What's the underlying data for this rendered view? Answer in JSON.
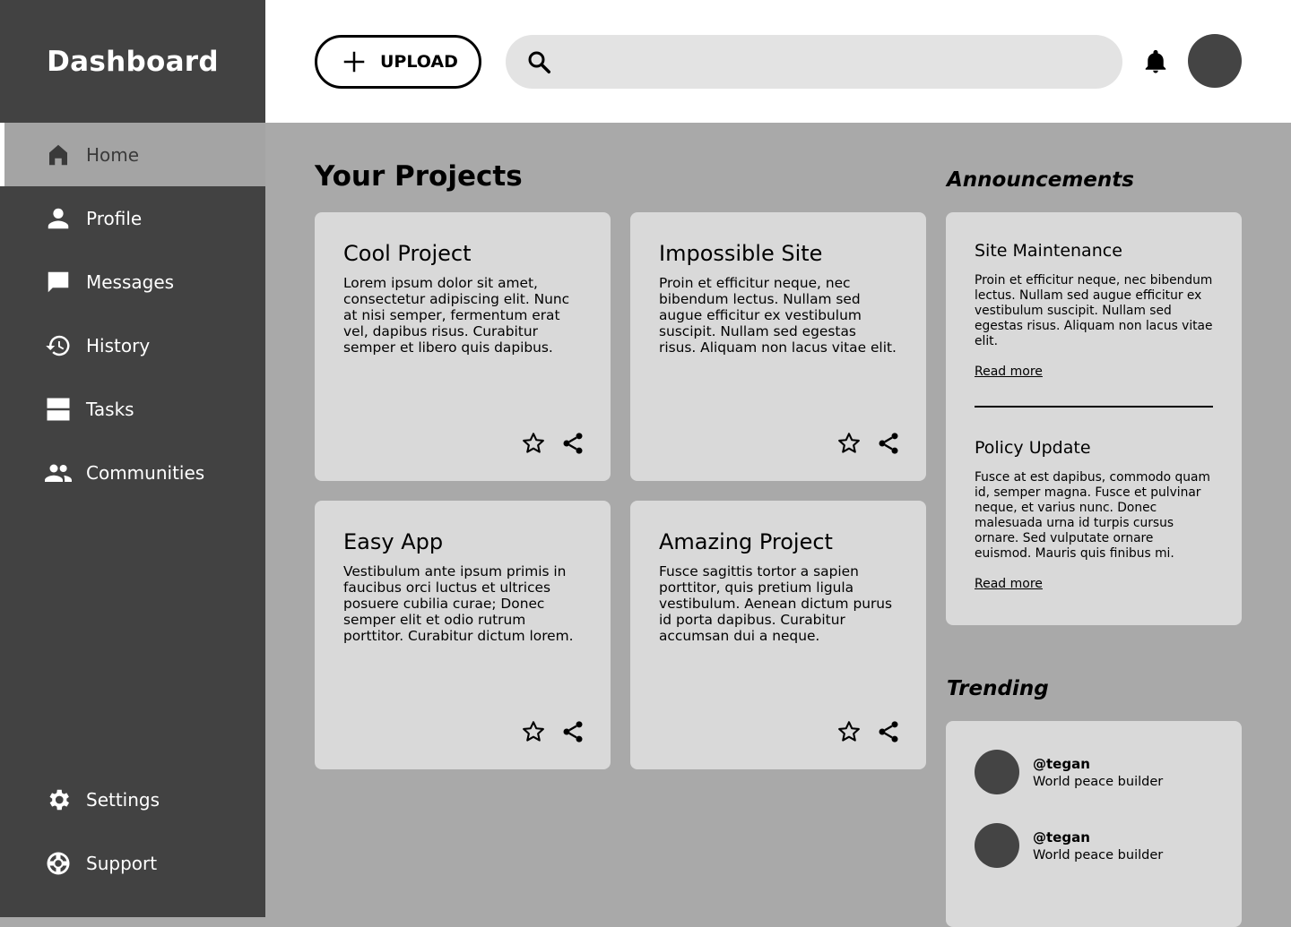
{
  "sidebar": {
    "brand": "Dashboard",
    "items": [
      {
        "label": "Home",
        "icon": "home-icon",
        "active": true
      },
      {
        "label": "Profile",
        "icon": "person-icon"
      },
      {
        "label": "Messages",
        "icon": "message-icon"
      },
      {
        "label": "History",
        "icon": "history-icon"
      },
      {
        "label": "Tasks",
        "icon": "tasks-icon"
      },
      {
        "label": "Communities",
        "icon": "people-icon"
      }
    ],
    "bottom": [
      {
        "label": "Settings",
        "icon": "gear-icon"
      },
      {
        "label": "Support",
        "icon": "support-icon"
      }
    ]
  },
  "topbar": {
    "upload_label": "UPLOAD",
    "search_placeholder": ""
  },
  "main": {
    "title": "Your Projects",
    "projects": [
      {
        "title": "Cool Project",
        "body": "Lorem ipsum dolor sit amet, consectetur adipiscing elit. Nunc at nisi semper, fermentum erat vel, dapibus risus. Curabitur semper et libero quis dapibus."
      },
      {
        "title": "Impossible Site",
        "body": "Proin et efficitur neque, nec bibendum lectus. Nullam sed augue efficitur ex vestibulum suscipit. Nullam sed egestas risus. Aliquam non lacus vitae elit."
      },
      {
        "title": "Easy App",
        "body": "Vestibulum ante ipsum primis in faucibus orci luctus et ultrices posuere cubilia curae; Donec semper elit et odio rutrum porttitor. Curabitur dictum lorem."
      },
      {
        "title": "Amazing Project",
        "body": "Fusce sagittis tortor a sapien porttitor, quis pretium ligula vestibulum. Aenean dictum purus id porta dapibus. Curabitur accumsan dui a neque."
      }
    ]
  },
  "announcements": {
    "title": "Announcements",
    "items": [
      {
        "title": "Site Maintenance",
        "body": "Proin et efficitur neque, nec bibendum lectus. Nullam sed augue efficitur ex vestibulum suscipit. Nullam sed egestas risus. Aliquam non lacus vitae elit.",
        "link": "Read more"
      },
      {
        "title": "Policy Update",
        "body": "Fusce at est dapibus, commodo quam id, semper magna. Fusce et pulvinar neque, et varius nunc. Donec malesuada urna id turpis cursus ornare. Sed vulputate ornare euismod. Mauris quis finibus mi.",
        "link": "Read more"
      }
    ]
  },
  "trending": {
    "title": "Trending",
    "items": [
      {
        "handle": "@tegan",
        "desc": "World peace builder"
      },
      {
        "handle": "@tegan",
        "desc": "World peace builder"
      }
    ]
  },
  "colors": {
    "sidebar": "#424242",
    "content_bg": "#a9a9a9",
    "card": "#d9d9d9",
    "active_nav": "#a4a4a4"
  }
}
